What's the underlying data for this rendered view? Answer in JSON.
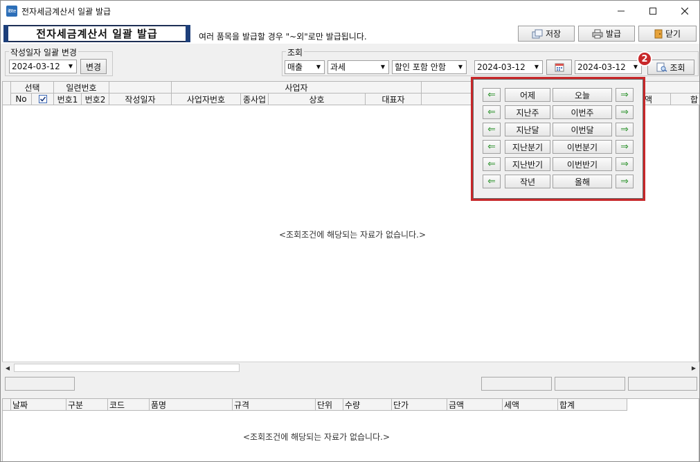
{
  "window": {
    "title": "전자세금계산서 일괄 발급",
    "icon_text": "iBte"
  },
  "header": {
    "form_title": "전자세금계산서 일괄 발급",
    "note": "여러 품목을 발급할 경우 \"~외\"로만 발급됩니다.",
    "save_label": "저장",
    "issue_label": "발급",
    "close_label": "닫기"
  },
  "batch_change": {
    "legend": "작성일자 일괄 변경",
    "date_value": "2024-03-12",
    "change_label": "변경"
  },
  "query": {
    "legend": "조회",
    "type_value": "매출",
    "tax_value": "과세",
    "discount_value": "할인 포함 안함",
    "from_date": "2024-03-12",
    "to_date": "2024-03-12",
    "search_label": "조회"
  },
  "grid_top": {
    "group_select": "선택",
    "group_serial": "일련번호",
    "group_business": "사업자",
    "col_no": "No",
    "col_num1": "번호1",
    "col_num2": "번호2",
    "col_date": "작성일자",
    "col_bizno": "사업자번호",
    "col_branch": "종사업",
    "col_company": "상호",
    "col_ceo": "대표자",
    "col_amount_partial": "액",
    "col_total_partial": "합",
    "empty_message": "<조회조건에 해당되는 자료가 없습니다.>"
  },
  "grid_bottom": {
    "columns": [
      "날짜",
      "구분",
      "코드",
      "품명",
      "규격",
      "단위",
      "수량",
      "단가",
      "금액",
      "세액",
      "합계"
    ],
    "empty_message": "<조회조건에 해당되는 자료가 없습니다.>"
  },
  "date_popup": {
    "rows": [
      {
        "left": "어제",
        "right": "오늘"
      },
      {
        "left": "지난주",
        "right": "이번주"
      },
      {
        "left": "지난달",
        "right": "이번달"
      },
      {
        "left": "지난분기",
        "right": "이번분기"
      },
      {
        "left": "지난반기",
        "right": "이번반기"
      },
      {
        "left": "작년",
        "right": "올해"
      }
    ]
  },
  "annotation": {
    "badge_number": "2",
    "badge_color": "#c8282a"
  }
}
